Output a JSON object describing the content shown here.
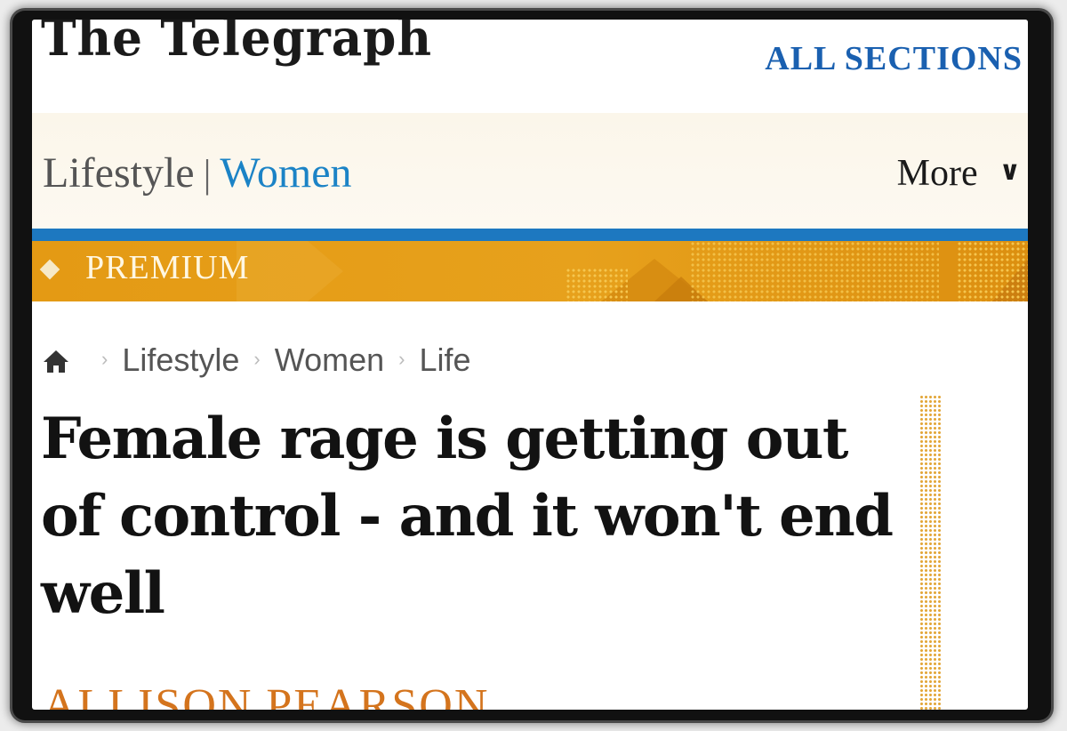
{
  "masthead": {
    "logo": "The Telegraph",
    "all_sections": "ALL SECTIONS"
  },
  "section_nav": {
    "parent": "Lifestyle",
    "separator": "|",
    "current": "Women",
    "more": "More"
  },
  "premium": {
    "label": "PREMIUM"
  },
  "breadcrumb": {
    "items": [
      "Lifestyle",
      "Women",
      "Life"
    ]
  },
  "article": {
    "headline": "Female rage is getting out of control - and it won't end well",
    "author": "ALLISON PEARSON"
  },
  "colors": {
    "brand_blue": "#1a60b0",
    "section_blue": "#1b83c6",
    "premium_gold": "#e49a14",
    "author_orange": "#d4741d"
  },
  "icons": [
    "home-icon",
    "chevron-down-icon",
    "chevron-right-icon",
    "diamond-icon"
  ]
}
